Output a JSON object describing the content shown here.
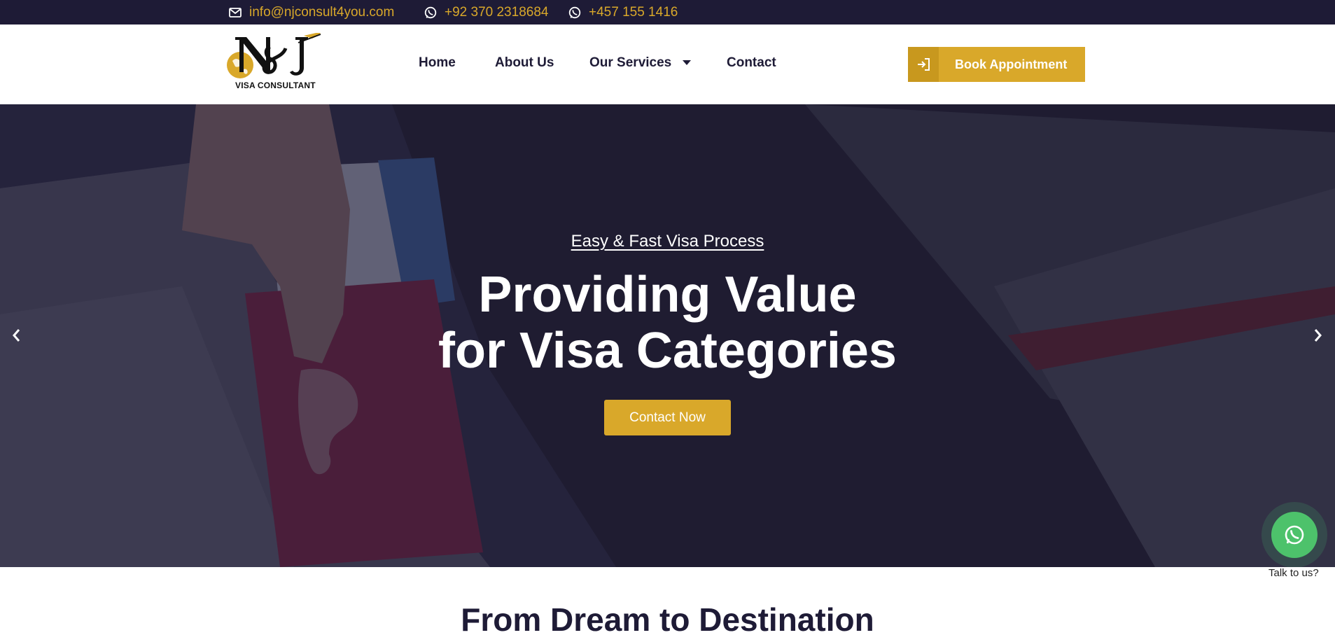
{
  "topbar": {
    "email": "info@njconsult4you.com",
    "phone_1": "+92 370 2318684",
    "phone_2": "+457 155 1416",
    "icons": [
      "envelope-icon",
      "whatsapp-icon",
      "whatsapp-icon"
    ]
  },
  "logo": {
    "mark": "N&J",
    "tagline": "VISA CONSULTANT"
  },
  "nav": {
    "home": "Home",
    "about": "About Us",
    "services": "Our Services",
    "contact": "Contact"
  },
  "cta": {
    "book_label": "Book Appointment"
  },
  "hero": {
    "kicker": "Easy & Fast Visa Process",
    "title_line_1": "Providing Value",
    "title_line_2": "for Visa Categories",
    "button_label": "Contact Now"
  },
  "whatsapp_widget": {
    "label": "Talk to us?"
  },
  "section": {
    "title": "From Dream to Destination"
  },
  "colors": {
    "navy": "#1e1b36",
    "gold": "#d9a82a",
    "whatsapp_green": "#4dc26b",
    "white": "#ffffff"
  }
}
